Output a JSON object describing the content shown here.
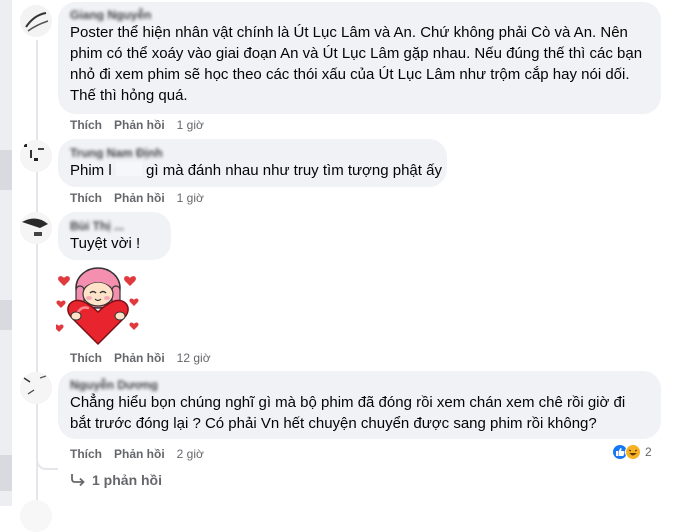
{
  "comments": [
    {
      "author": "Giang Nguyễn",
      "text": "Poster thể hiện nhân vật chính là Út Lục Lâm và An. Chứ không phải Cò và An. Nên phim có thể xoáy vào giai đoạn An và Út Lục Lâm gặp nhau. Nếu đúng thế thì các bạn nhỏ đi xem phim sẽ học theo các thói xấu của Út Lục Lâm như trộm cắp hay nói dối. Thế thì hỏng quá.",
      "like_label": "Thích",
      "reply_label": "Phản hồi",
      "time": "1 giờ"
    },
    {
      "author": "Trung Nam Định",
      "text_before": "Phim l",
      "text_after": "gì mà đánh nhau như truy tìm tượng phật ấy",
      "like_label": "Thích",
      "reply_label": "Phản hồi",
      "time": "1 giờ"
    },
    {
      "author": "Bùi Thị ...",
      "text": "Tuyệt vời !",
      "sticker": "heart-hug-girl-sticker",
      "like_label": "Thích",
      "reply_label": "Phản hồi",
      "time": "12 giờ"
    },
    {
      "author": "Nguyễn Dương",
      "text": "Chẳng hiểu bọn chúng nghĩ gì mà bộ phim đã đóng rồi xem chán xem chê rồi giờ đi bắt trước đóng lại ? Có phải Vn hết chuyện chuyển được sang phim rồi không?",
      "like_label": "Thích",
      "reply_label": "Phản hồi",
      "time": "2 giờ",
      "reaction_count": "2",
      "reactions": [
        "like-icon",
        "haha-icon"
      ],
      "replies_label": "1 phản hồi"
    }
  ],
  "colors": {
    "bubble": "#f0f2f5",
    "meta": "#65676b",
    "like_blue": "#1877f2",
    "haha_yellow": "#f7b125"
  }
}
